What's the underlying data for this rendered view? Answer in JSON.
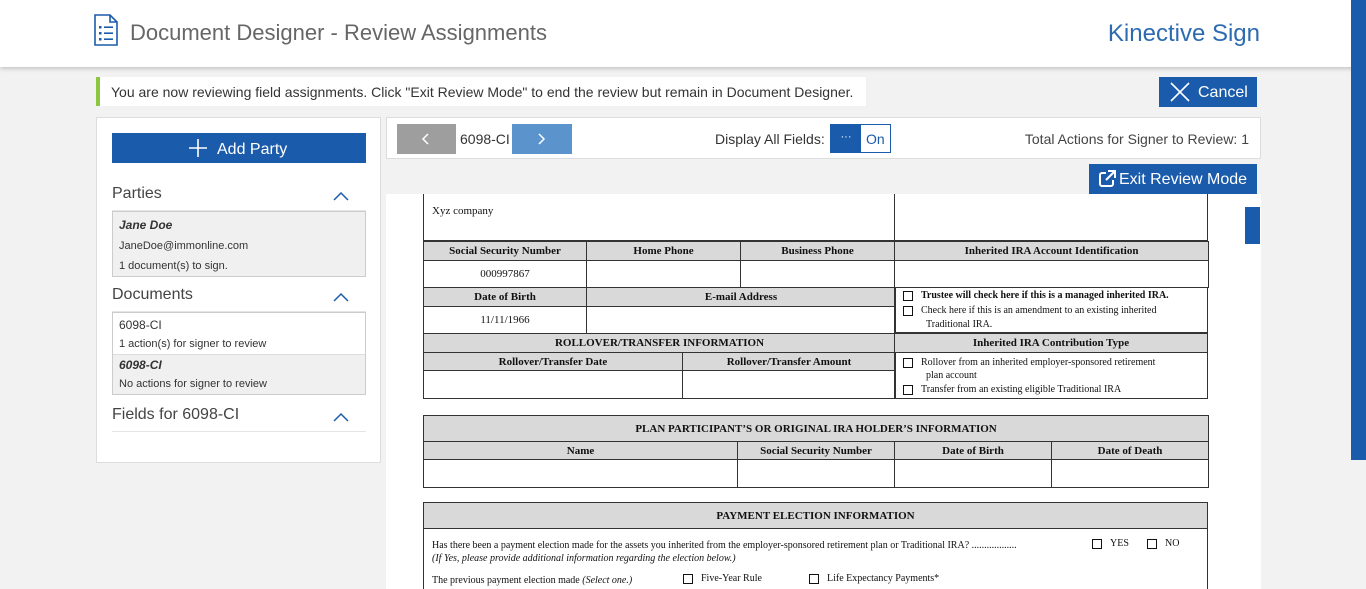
{
  "header": {
    "title": "Document Designer - Review Assignments",
    "brand": "Kinective Sign"
  },
  "notice": "You are now reviewing field assignments. Click \"Exit Review Mode\" to end the review but remain in Document Designer.",
  "buttons": {
    "cancel": "Cancel",
    "add_party": "Add Party",
    "exit_review": "Exit Review Mode"
  },
  "sidebar": {
    "parties_title": "Parties",
    "party": {
      "name": "Jane Doe",
      "email": "JaneDoe@immonline.com",
      "status": "1 document(s) to sign."
    },
    "documents_title": "Documents",
    "documents": [
      {
        "name": "6098-CI",
        "status": "1 action(s) for signer to review"
      },
      {
        "name": "6098-CI",
        "status": "No actions for signer to review"
      }
    ],
    "fields_title": "Fields for 6098-CI"
  },
  "toolbar": {
    "doc_name": "6098-CI",
    "display_label": "Display All Fields:",
    "toggle_knob": "···",
    "toggle_value": "On",
    "total_label": "Total Actions for Signer to Review: 1"
  },
  "form": {
    "company": "Xyz company",
    "ssn_h": "Social Security Number",
    "home_h": "Home Phone",
    "biz_h": "Business Phone",
    "ira_id_h": "Inherited IRA Account Identification",
    "ssn": "000997867",
    "dob_h": "Date of Birth",
    "email_h": "E-mail Address",
    "dob": "11/11/1966",
    "trustee": "Trustee will check here if this is a managed inherited IRA.",
    "amend_1": "Check here if this is an amendment to an existing inherited",
    "amend_2": "Traditional IRA.",
    "rollover_h": "ROLLOVER/TRANSFER INFORMATION",
    "rollover_date_h": "Rollover/Transfer Date",
    "rollover_amt_h": "Rollover/Transfer Amount",
    "contrib_h": "Inherited IRA Contribution Type",
    "contrib_1a": "Rollover from an inherited employer-sponsored retirement",
    "contrib_1b": "plan account",
    "contrib_2": "Transfer from an existing eligible Traditional IRA",
    "plan_h": "PLAN PARTICIPANT’S OR ORIGINAL IRA HOLDER’S INFORMATION",
    "plan_name": "Name",
    "plan_ssn": "Social Security Number",
    "plan_dob": "Date of Birth",
    "plan_dod": "Date of Death",
    "pay_h": "PAYMENT ELECTION INFORMATION",
    "pay_q": "Has there been a payment election made for the assets you inherited from the employer-sponsored retirement plan or Traditional IRA? ..................",
    "yes": "YES",
    "no": "NO",
    "pay_note": "(If Yes, please provide additional information regarding the election below.)",
    "prev": "The previous payment election made",
    "prev_sel": "(Select one.)",
    "five": "Five-Year Rule",
    "life": "Life Expectancy Payments*"
  }
}
